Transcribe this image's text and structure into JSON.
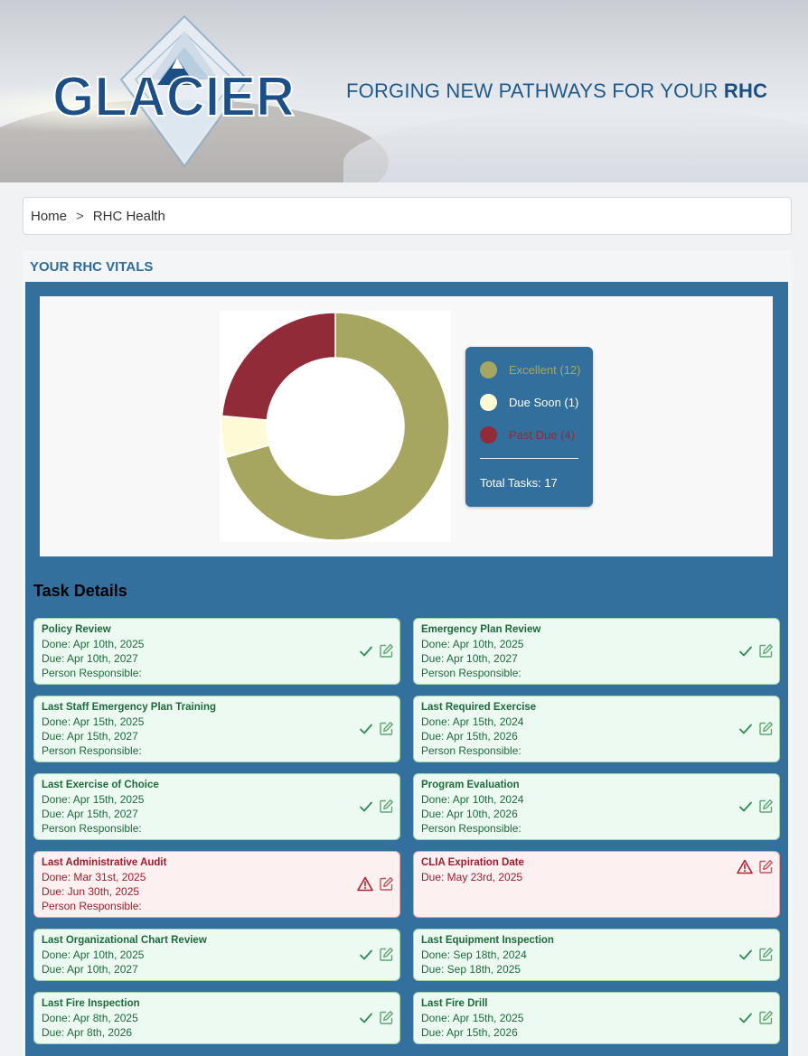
{
  "header": {
    "logo_text": "GLACIER",
    "tagline_prefix": "FORGING NEW PATHWAYS FOR YOUR ",
    "tagline_bold": "RHC"
  },
  "breadcrumb": {
    "home": "Home",
    "separator": ">",
    "current": "RHC Health"
  },
  "vitals": {
    "title": "YOUR RHC VITALS",
    "legend": [
      {
        "label": "Excellent (12)",
        "color": "#a7a660",
        "text_color": "#a7a660"
      },
      {
        "label": "Due Soon (1)",
        "color": "#fffad6",
        "text_color": "#ffffff"
      },
      {
        "label": "Past Due (4)",
        "color": "#912b37",
        "text_color": "#912b37"
      }
    ],
    "total_label": "Total Tasks: 17"
  },
  "chart_data": {
    "type": "pie",
    "categories": [
      "Excellent",
      "Due Soon",
      "Past Due"
    ],
    "values": [
      12,
      1,
      4
    ],
    "colors": [
      "#a7a660",
      "#fffad6",
      "#912b37"
    ],
    "donut": true
  },
  "tasks": {
    "heading": "Task Details",
    "items": [
      {
        "title": "Policy Review",
        "lines": [
          "Done: Apr 10th, 2025",
          "Due: Apr 10th, 2027",
          "Person Responsible:"
        ],
        "status": "ok"
      },
      {
        "title": "Emergency Plan Review",
        "lines": [
          "Done: Apr 10th, 2025",
          "Due: Apr 10th, 2027",
          "Person Responsible:"
        ],
        "status": "ok"
      },
      {
        "title": "Last Staff Emergency Plan Training",
        "lines": [
          "Done: Apr 15th, 2025",
          "Due: Apr 15th, 2027",
          "Person Responsible:"
        ],
        "status": "ok"
      },
      {
        "title": "Last Required Exercise",
        "lines": [
          "Done: Apr 15th, 2024",
          "Due: Apr 15th, 2026",
          "Person Responsible:"
        ],
        "status": "ok"
      },
      {
        "title": "Last Exercise of Choice",
        "lines": [
          "Done: Apr 15th, 2025",
          "Due: Apr 15th, 2027",
          "Person Responsible:"
        ],
        "status": "ok"
      },
      {
        "title": "Program Evaluation",
        "lines": [
          "Done: Apr 10th, 2024",
          "Due: Apr 10th, 2026",
          "Person Responsible:"
        ],
        "status": "ok"
      },
      {
        "title": "Last Administrative Audit",
        "lines": [
          "Done: Mar 31st, 2025",
          "Due: Jun 30th, 2025",
          "Person Responsible:"
        ],
        "status": "bad"
      },
      {
        "title": "CLIA Expiration Date",
        "lines": [
          "Due: May 23rd, 2025"
        ],
        "status": "bad"
      },
      {
        "title": "Last Organizational Chart Review",
        "lines": [
          "Done: Apr 10th, 2025",
          "Due: Apr 10th, 2027"
        ],
        "status": "ok"
      },
      {
        "title": "Last Equipment Inspection",
        "lines": [
          "Done: Sep 18th, 2024",
          "Due: Sep 18th, 2025"
        ],
        "status": "ok"
      },
      {
        "title": "Last Fire Inspection",
        "lines": [
          "Done: Apr 8th, 2025",
          "Due: Apr 8th, 2026"
        ],
        "status": "ok"
      },
      {
        "title": "Last Fire Drill",
        "lines": [
          "Done: Apr 15th, 2025",
          "Due: Apr 15th, 2026"
        ],
        "status": "ok"
      }
    ]
  }
}
